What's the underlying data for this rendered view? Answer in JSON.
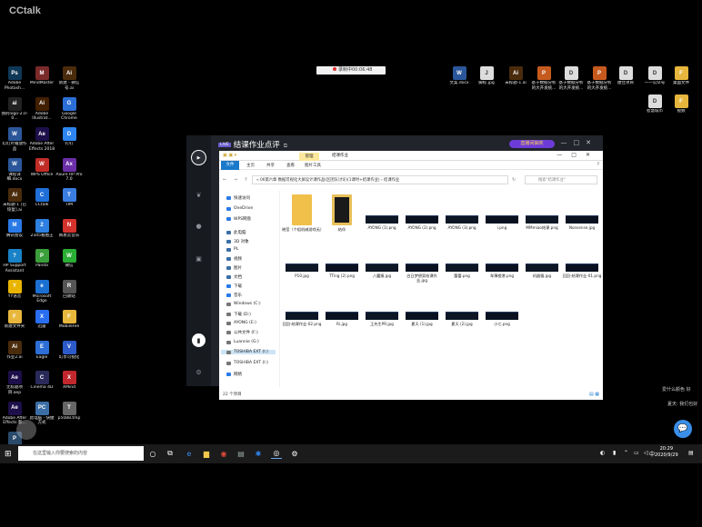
{
  "app_title": "CCtalk",
  "recording": "录制中00:06:48",
  "desktop_left": [
    {
      "label": "Adobe Photosh...",
      "abbr": "Ps",
      "color": "#0f3857"
    },
    {
      "label": "MindMaster",
      "abbr": "M",
      "color": "#7b2a2a"
    },
    {
      "label": "新建 - 微信号.ai",
      "abbr": "Ai",
      "color": "#4a2b0c"
    },
    {
      "label": "我的logo-2.0-0...",
      "abbr": "ai",
      "color": "#222"
    },
    {
      "label": "Adobe Illustrat...",
      "abbr": "Ai",
      "color": "#421f00"
    },
    {
      "label": "Google Chrome",
      "abbr": "G",
      "color": "#2b6fd6"
    },
    {
      "label": "幻灯片播放作品",
      "abbr": "W",
      "color": "#2b579a"
    },
    {
      "label": "Adobe After Effects 2018",
      "abbr": "Ae",
      "color": "#1d0f4a"
    },
    {
      "label": "钉钉",
      "abbr": "D",
      "color": "#2e85f0"
    },
    {
      "label": "课程详细.docx",
      "abbr": "W",
      "color": "#2b579a"
    },
    {
      "label": "WPS Office",
      "abbr": "W",
      "color": "#c12d26"
    },
    {
      "label": "Axure RP Pro 7.0",
      "abbr": "Ax",
      "color": "#6b2fa8"
    },
    {
      "label": "未标题-1 [已恢复].ai",
      "abbr": "Ai",
      "color": "#4a2b0c"
    },
    {
      "label": "CCtalk",
      "abbr": "C",
      "color": "#1f6fd8"
    },
    {
      "label": "TIM",
      "abbr": "T",
      "color": "#3a7de0"
    },
    {
      "label": "腾讯会议",
      "abbr": "M",
      "color": "#2a7ae6"
    },
    {
      "label": "2345看图王",
      "abbr": "2",
      "color": "#2d7fe0"
    },
    {
      "label": "网易云音乐",
      "abbr": "N",
      "color": "#d4322d"
    },
    {
      "label": "HP Support Assistant",
      "abbr": "?",
      "color": "#1a82c6"
    },
    {
      "label": "Panda",
      "abbr": "P",
      "color": "#3a9e3a"
    },
    {
      "label": "微信",
      "abbr": "W",
      "color": "#2aae35"
    },
    {
      "label": "YY语音",
      "abbr": "Y",
      "color": "#e8b400"
    },
    {
      "label": "Microsoft Edge",
      "abbr": "e",
      "color": "#1b6fd1"
    },
    {
      "label": "回收站",
      "abbr": "R",
      "color": "#555"
    },
    {
      "label": "新建文件夹",
      "abbr": "F",
      "color": "#e7b63c"
    },
    {
      "label": "迅雷",
      "abbr": "X",
      "color": "#2a6ef0"
    },
    {
      "label": "MobileFile",
      "abbr": "F",
      "color": "#e7b63c"
    },
    {
      "label": "作业2.ai",
      "abbr": "Ai",
      "color": "#4a2b0c"
    },
    {
      "label": "Eagle",
      "abbr": "E",
      "color": "#2d6fd6"
    },
    {
      "label": "幻享可视化",
      "abbr": "V",
      "color": "#2d5ac9"
    },
    {
      "label": "无标题项目.aep",
      "abbr": "Ae",
      "color": "#1d0f4a"
    },
    {
      "label": "Cinema 4D",
      "abbr": "C",
      "color": "#2a2a5a"
    },
    {
      "label": "XMind",
      "abbr": "X",
      "color": "#c1272d"
    },
    {
      "label": "Adobe After Effects 影...",
      "abbr": "Ae",
      "color": "#1d0f4a"
    },
    {
      "label": "此电脑 - 快捷方式",
      "abbr": "PC",
      "color": "#3b6ea5"
    },
    {
      "label": "p5088.tmp",
      "abbr": "T",
      "color": "#666"
    },
    {
      "label": "微信截图_2020092...",
      "abbr": "P",
      "color": "#2a4a6a"
    }
  ],
  "desktop_right_top": [
    {
      "label": "文案.docx",
      "abbr": "W",
      "color": "#2b579a"
    },
    {
      "label": "脚标.jpg",
      "abbr": "J",
      "color": "#ddd"
    },
    {
      "label": "未标题-1.ai",
      "abbr": "Ai",
      "color": "#4a2b0c"
    },
    {
      "label": "基于数据分析的大开发统...",
      "abbr": "P",
      "color": "#c65a1e"
    },
    {
      "label": "基于数据分析的大开发统...",
      "abbr": "D",
      "color": "#ddd"
    },
    {
      "label": "基于数据分析的大开发统...",
      "abbr": "P",
      "color": "#c65a1e"
    },
    {
      "label": "捷佳项目",
      "abbr": "D",
      "color": "#ddd"
    },
    {
      "label": "一一公众号",
      "abbr": "D",
      "color": "#ddd"
    },
    {
      "label": "桌面文件",
      "abbr": "F",
      "color": "#e7b63c"
    },
    {
      "label": "智慧城市",
      "abbr": "D",
      "color": "#ddd"
    },
    {
      "label": "视频",
      "abbr": "F",
      "color": "#e7b63c"
    }
  ],
  "cctalk": {
    "badge": "LIVE",
    "title": "结课作业点评",
    "promo": "直播间抽奖"
  },
  "explorer": {
    "manage_tab": "管理",
    "window_title": "结课作业",
    "ribbon": [
      "文件",
      "主页",
      "共享",
      "查看",
      "图片工具"
    ],
    "path": "« 06第六章 数据可视化大屏设计课作品(区团队讨论)(1课时+结课作业) › 结课作业",
    "search_placeholder": "搜索\"结课作业\"",
    "nav": [
      {
        "label": "快速访问",
        "color": "#2a7ae6"
      },
      {
        "label": "OneDrive",
        "color": "#2a7ae6"
      },
      {
        "label": "WPS网盘",
        "color": "#2a7ae6"
      },
      {
        "label": "此电脑",
        "color": "#3b6ea5"
      },
      {
        "label": "3D 对象",
        "color": "#3b6ea5"
      },
      {
        "label": "PL",
        "color": "#3b6ea5"
      },
      {
        "label": "视频",
        "color": "#3b6ea5"
      },
      {
        "label": "图片",
        "color": "#3b6ea5"
      },
      {
        "label": "文档",
        "color": "#3b6ea5"
      },
      {
        "label": "下载",
        "color": "#2a7ae6"
      },
      {
        "label": "音乐",
        "color": "#2a7ae6"
      },
      {
        "label": "Windows (C:)",
        "color": "#777"
      },
      {
        "label": "下载 (D:)",
        "color": "#777"
      },
      {
        "label": "AYONG (E:)",
        "color": "#777"
      },
      {
        "label": "公共文件 (F:)",
        "color": "#777"
      },
      {
        "label": "Luannie (G:)",
        "color": "#777"
      },
      {
        "label": "TOSHIBA EXT (I:)",
        "color": "#777",
        "selected": true
      },
      {
        "label": "TOSHIBA EXT (I:)",
        "color": "#777"
      },
      {
        "label": "网络",
        "color": "#2a7ae6"
      }
    ],
    "files": [
      {
        "name": "晓莹（个组机械游戏无）",
        "kind": "folder"
      },
      {
        "name": "结伴",
        "kind": "folder-dark"
      },
      {
        "name": "AYONG (1).png",
        "kind": "img"
      },
      {
        "name": "AYONG (2).png",
        "kind": "img"
      },
      {
        "name": "AYONG (3).png",
        "kind": "img"
      },
      {
        "name": "i.png",
        "kind": "img"
      },
      {
        "name": "MMmiao结课.png",
        "kind": "img"
      },
      {
        "name": "Nonsense.jpg",
        "kind": "img"
      },
      {
        "name": "P10.jpg",
        "kind": "img"
      },
      {
        "name": "TTing (2).png",
        "kind": "img"
      },
      {
        "name": "八魔猿.jpg",
        "kind": "img"
      },
      {
        "name": "白日梦想家结课作业.jpg",
        "kind": "img"
      },
      {
        "name": "蕾蕾.png",
        "kind": "img"
      },
      {
        "name": "车薄橙港.png",
        "kind": "img"
      },
      {
        "name": "机器猫.jpg",
        "kind": "img"
      },
      {
        "name": "回回-结课作业-01.png",
        "kind": "img"
      },
      {
        "name": "回回-结课作业-02.png",
        "kind": "img"
      },
      {
        "name": "Ri.jpg",
        "kind": "img"
      },
      {
        "name": "王先生PR.jpg",
        "kind": "img"
      },
      {
        "name": "夏天 (1).jpg",
        "kind": "img"
      },
      {
        "name": "夏天 (2).jpg",
        "kind": "img"
      },
      {
        "name": "小七.png",
        "kind": "img"
      }
    ],
    "status": "22 个项目"
  },
  "chat": [
    {
      "text": "爱什么颜色 好"
    },
    {
      "text": "夏天: 我们也好"
    }
  ],
  "taskbar": {
    "search_placeholder": "在这里输入你要搜索的内容",
    "ime": "中",
    "time": "20:29",
    "date": "2020/9/29"
  }
}
